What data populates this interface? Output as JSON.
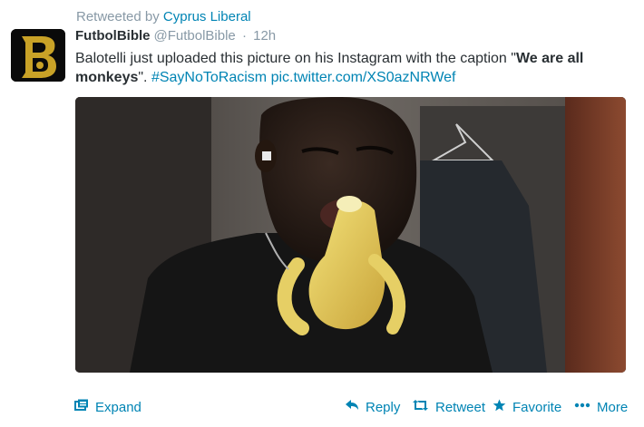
{
  "retweet": {
    "prefix": "Retweeted by",
    "user": "Cyprus Liberal"
  },
  "tweet": {
    "fullname": "FutbolBible",
    "handle": "@FutbolBible",
    "separator": "·",
    "time": "12h",
    "text_part1": "Balotelli just uploaded this picture on his Instagram with the caption \"",
    "text_bold": "We are all monkeys",
    "text_part2": "\". ",
    "hashtag": "#SayNoToRacism",
    "media_link": "pic.twitter.com/XS0azNRWef"
  },
  "actions": {
    "expand": "Expand",
    "reply": "Reply",
    "retweet": "Retweet",
    "favorite": "Favorite",
    "more": "More"
  },
  "colors": {
    "link": "#0084b4",
    "muted": "#8899a6",
    "text": "#292f33",
    "avatar_bg": "#0a0a0a",
    "avatar_gold": "#c9a227"
  },
  "icons": {
    "expand": "expand-icon",
    "reply": "reply-arrow-icon",
    "retweet": "retweet-arrows-icon",
    "favorite": "star-icon",
    "more": "ellipsis-icon"
  }
}
